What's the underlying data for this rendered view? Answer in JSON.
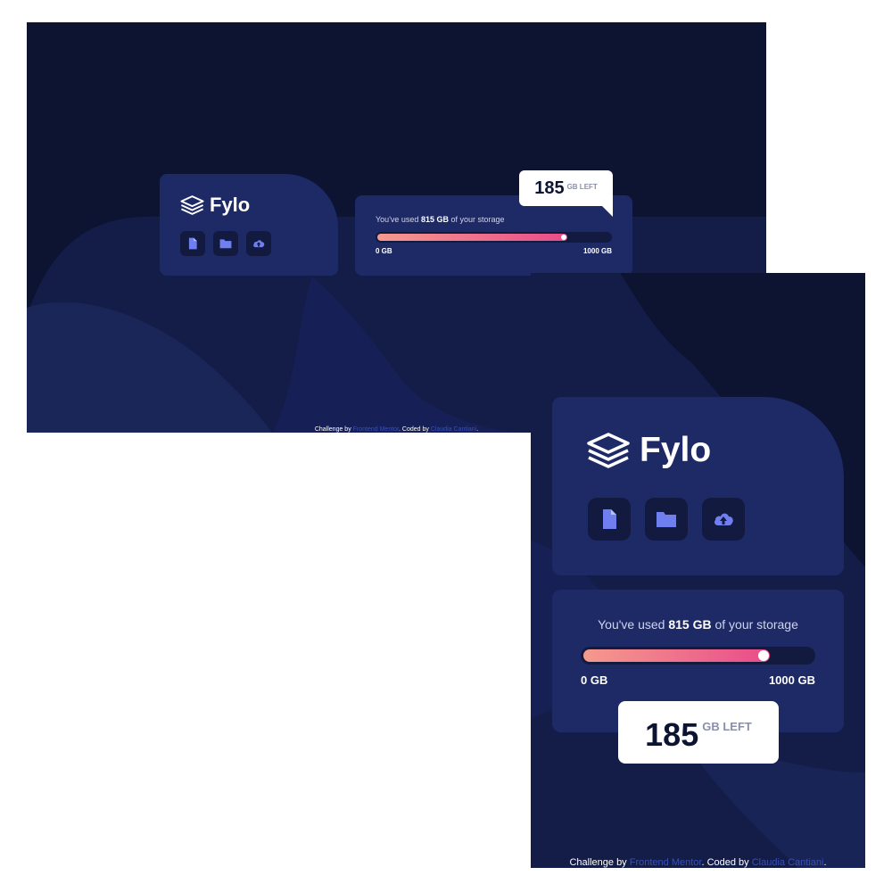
{
  "colors": {
    "page_bg": "#0c1432",
    "card_bg": "#1e2a66",
    "icon_bg": "#121a3f",
    "icon_fg": "#6f7ff0",
    "gradient_start": "#f59a8d",
    "gradient_end": "#e94b8a",
    "link": "#3a4fb5"
  },
  "brand": {
    "name": "Fylo",
    "logo_icon": "stacked-layers-icon"
  },
  "icons": [
    {
      "name": "document-icon"
    },
    {
      "name": "folder-icon"
    },
    {
      "name": "upload-icon"
    }
  ],
  "usage": {
    "prefix": "You've used ",
    "used": "815 GB",
    "suffix": " of your storage",
    "progress": 0.815,
    "min_label": "0 GB",
    "max_label": "1000 GB"
  },
  "remaining": {
    "value": "185",
    "unit": "GB LEFT"
  },
  "footer": {
    "prefix": "Challenge by ",
    "challenge_link": "Frontend Mentor",
    "middle": ". Coded by ",
    "author_link": "Claudia Cantiani",
    "suffix": "."
  }
}
